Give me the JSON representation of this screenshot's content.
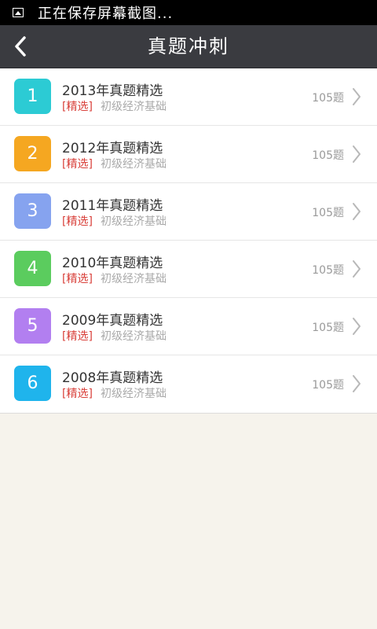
{
  "status_bar": {
    "icon": "screenshot-image-icon",
    "text": "正在保存屏幕截图..."
  },
  "header": {
    "back_icon": "chevron-left-icon",
    "title": "真题冲刺"
  },
  "colors": {
    "header_bg": "#3a3b40",
    "tag": "#d9413b"
  },
  "items": [
    {
      "number": "1",
      "title": "2013年真题精选",
      "tag": "[精选]",
      "subject": "初级经济基础",
      "count": "105题",
      "color": "#2ccbd4"
    },
    {
      "number": "2",
      "title": "2012年真题精选",
      "tag": "[精选]",
      "subject": "初级经济基础",
      "count": "105题",
      "color": "#f5a721"
    },
    {
      "number": "3",
      "title": "2011年真题精选",
      "tag": "[精选]",
      "subject": "初级经济基础",
      "count": "105题",
      "color": "#86a3ef"
    },
    {
      "number": "4",
      "title": "2010年真题精选",
      "tag": "[精选]",
      "subject": "初级经济基础",
      "count": "105题",
      "color": "#5bcc5e"
    },
    {
      "number": "5",
      "title": "2009年真题精选",
      "tag": "[精选]",
      "subject": "初级经济基础",
      "count": "105题",
      "color": "#b27ff0"
    },
    {
      "number": "6",
      "title": "2008年真题精选",
      "tag": "[精选]",
      "subject": "初级经济基础",
      "count": "105题",
      "color": "#1fb4ec"
    }
  ]
}
